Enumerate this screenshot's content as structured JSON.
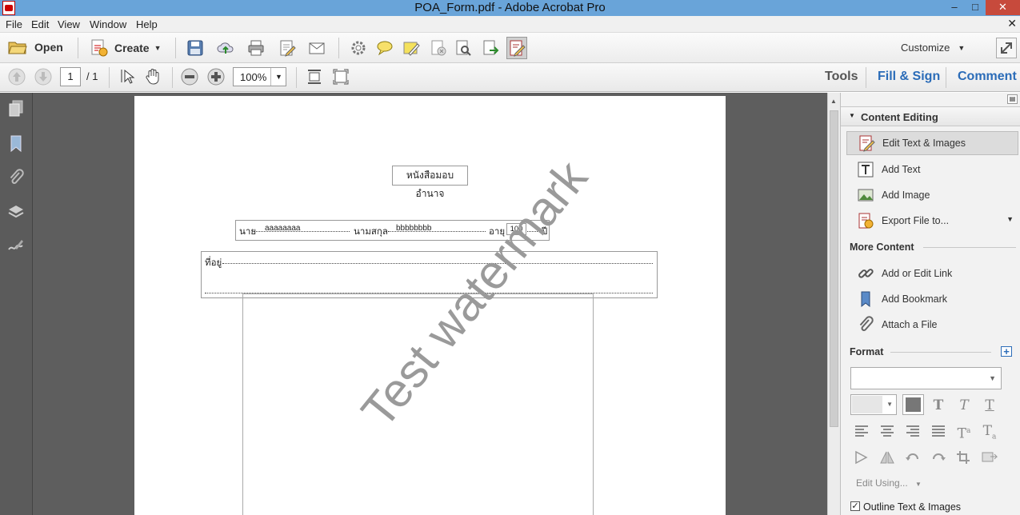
{
  "window": {
    "title": "POA_Form.pdf - Adobe Acrobat Pro",
    "min": "‒",
    "max": "□",
    "close": "✕"
  },
  "menu": {
    "items": [
      "File",
      "Edit",
      "View",
      "Window",
      "Help"
    ],
    "close": "✕"
  },
  "toolbar": {
    "open": "Open",
    "create": "Create",
    "customize": "Customize"
  },
  "nav": {
    "page_current": "1",
    "page_total": "/ 1",
    "zoom": "100%"
  },
  "tabs": {
    "tools": "Tools",
    "fill_sign": "Fill & Sign",
    "comment": "Comment"
  },
  "document": {
    "heading": "หนังสือมอบอำนาจ",
    "name_label": "นาย",
    "name_value": "aaaaaaaa",
    "surname_label": "นามสกุล",
    "surname_value": "bbbbbbbb",
    "age_label": "อายุ",
    "age_value": "100",
    "year_label": "ปี",
    "address_label": "ที่อยู่",
    "watermark": "Test watermark"
  },
  "panel": {
    "content_editing": "Content Editing",
    "edit_text_images": "Edit Text & Images",
    "add_text": "Add Text",
    "add_image": "Add Image",
    "export_file": "Export File to...",
    "more_content": "More Content",
    "add_link": "Add or Edit Link",
    "add_bookmark": "Add Bookmark",
    "attach_file": "Attach a File",
    "format": "Format",
    "edit_using": "Edit Using...",
    "outline": "Outline Text & Images"
  }
}
